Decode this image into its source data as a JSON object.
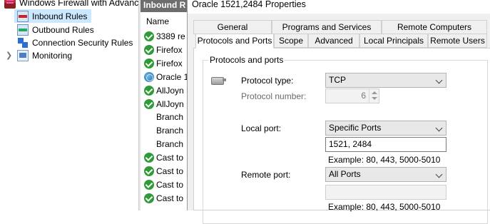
{
  "tree": {
    "root": "Windows Firewall with Advance",
    "items": [
      "Inbound Rules",
      "Outbound Rules",
      "Connection Security Rules",
      "Monitoring"
    ]
  },
  "rules_pane": {
    "header": "Inbound R",
    "column": "Name",
    "rules": [
      {
        "name": "3389 re",
        "icon": "allow"
      },
      {
        "name": "Firefox",
        "icon": "allow"
      },
      {
        "name": "Firefox",
        "icon": "allow"
      },
      {
        "name": "Oracle 1",
        "icon": "globe"
      },
      {
        "name": "AllJoyn",
        "icon": "allow"
      },
      {
        "name": "AllJoyn",
        "icon": "allow"
      },
      {
        "name": "Branch",
        "icon": "none"
      },
      {
        "name": "Branch",
        "icon": "none"
      },
      {
        "name": "Branch",
        "icon": "none"
      },
      {
        "name": "Cast to",
        "icon": "allow"
      },
      {
        "name": "Cast to",
        "icon": "allow"
      },
      {
        "name": "Cast to",
        "icon": "allow"
      },
      {
        "name": "Cast to",
        "icon": "allow"
      }
    ]
  },
  "dialog": {
    "title": "Oracle 1521,2484 Properties",
    "tabs_row1": [
      "General",
      "Programs and Services",
      "Remote Computers"
    ],
    "tabs_row2": [
      "Protocols and Ports",
      "Scope",
      "Advanced",
      "Local Principals",
      "Remote Users"
    ],
    "active_tab": "Protocols and Ports",
    "group_title": "Protocols and ports",
    "protocol_type_label": "Protocol type:",
    "protocol_type_value": "TCP",
    "protocol_number_label": "Protocol number:",
    "protocol_number_value": "6",
    "local_port_label": "Local port:",
    "local_port_mode": "Specific Ports",
    "local_port_value": "1521, 2484",
    "local_example": "Example: 80, 443, 5000-5010",
    "remote_port_label": "Remote port:",
    "remote_port_mode": "All Ports",
    "remote_port_value": "",
    "remote_example": "Example: 80, 443, 5000-5010"
  }
}
